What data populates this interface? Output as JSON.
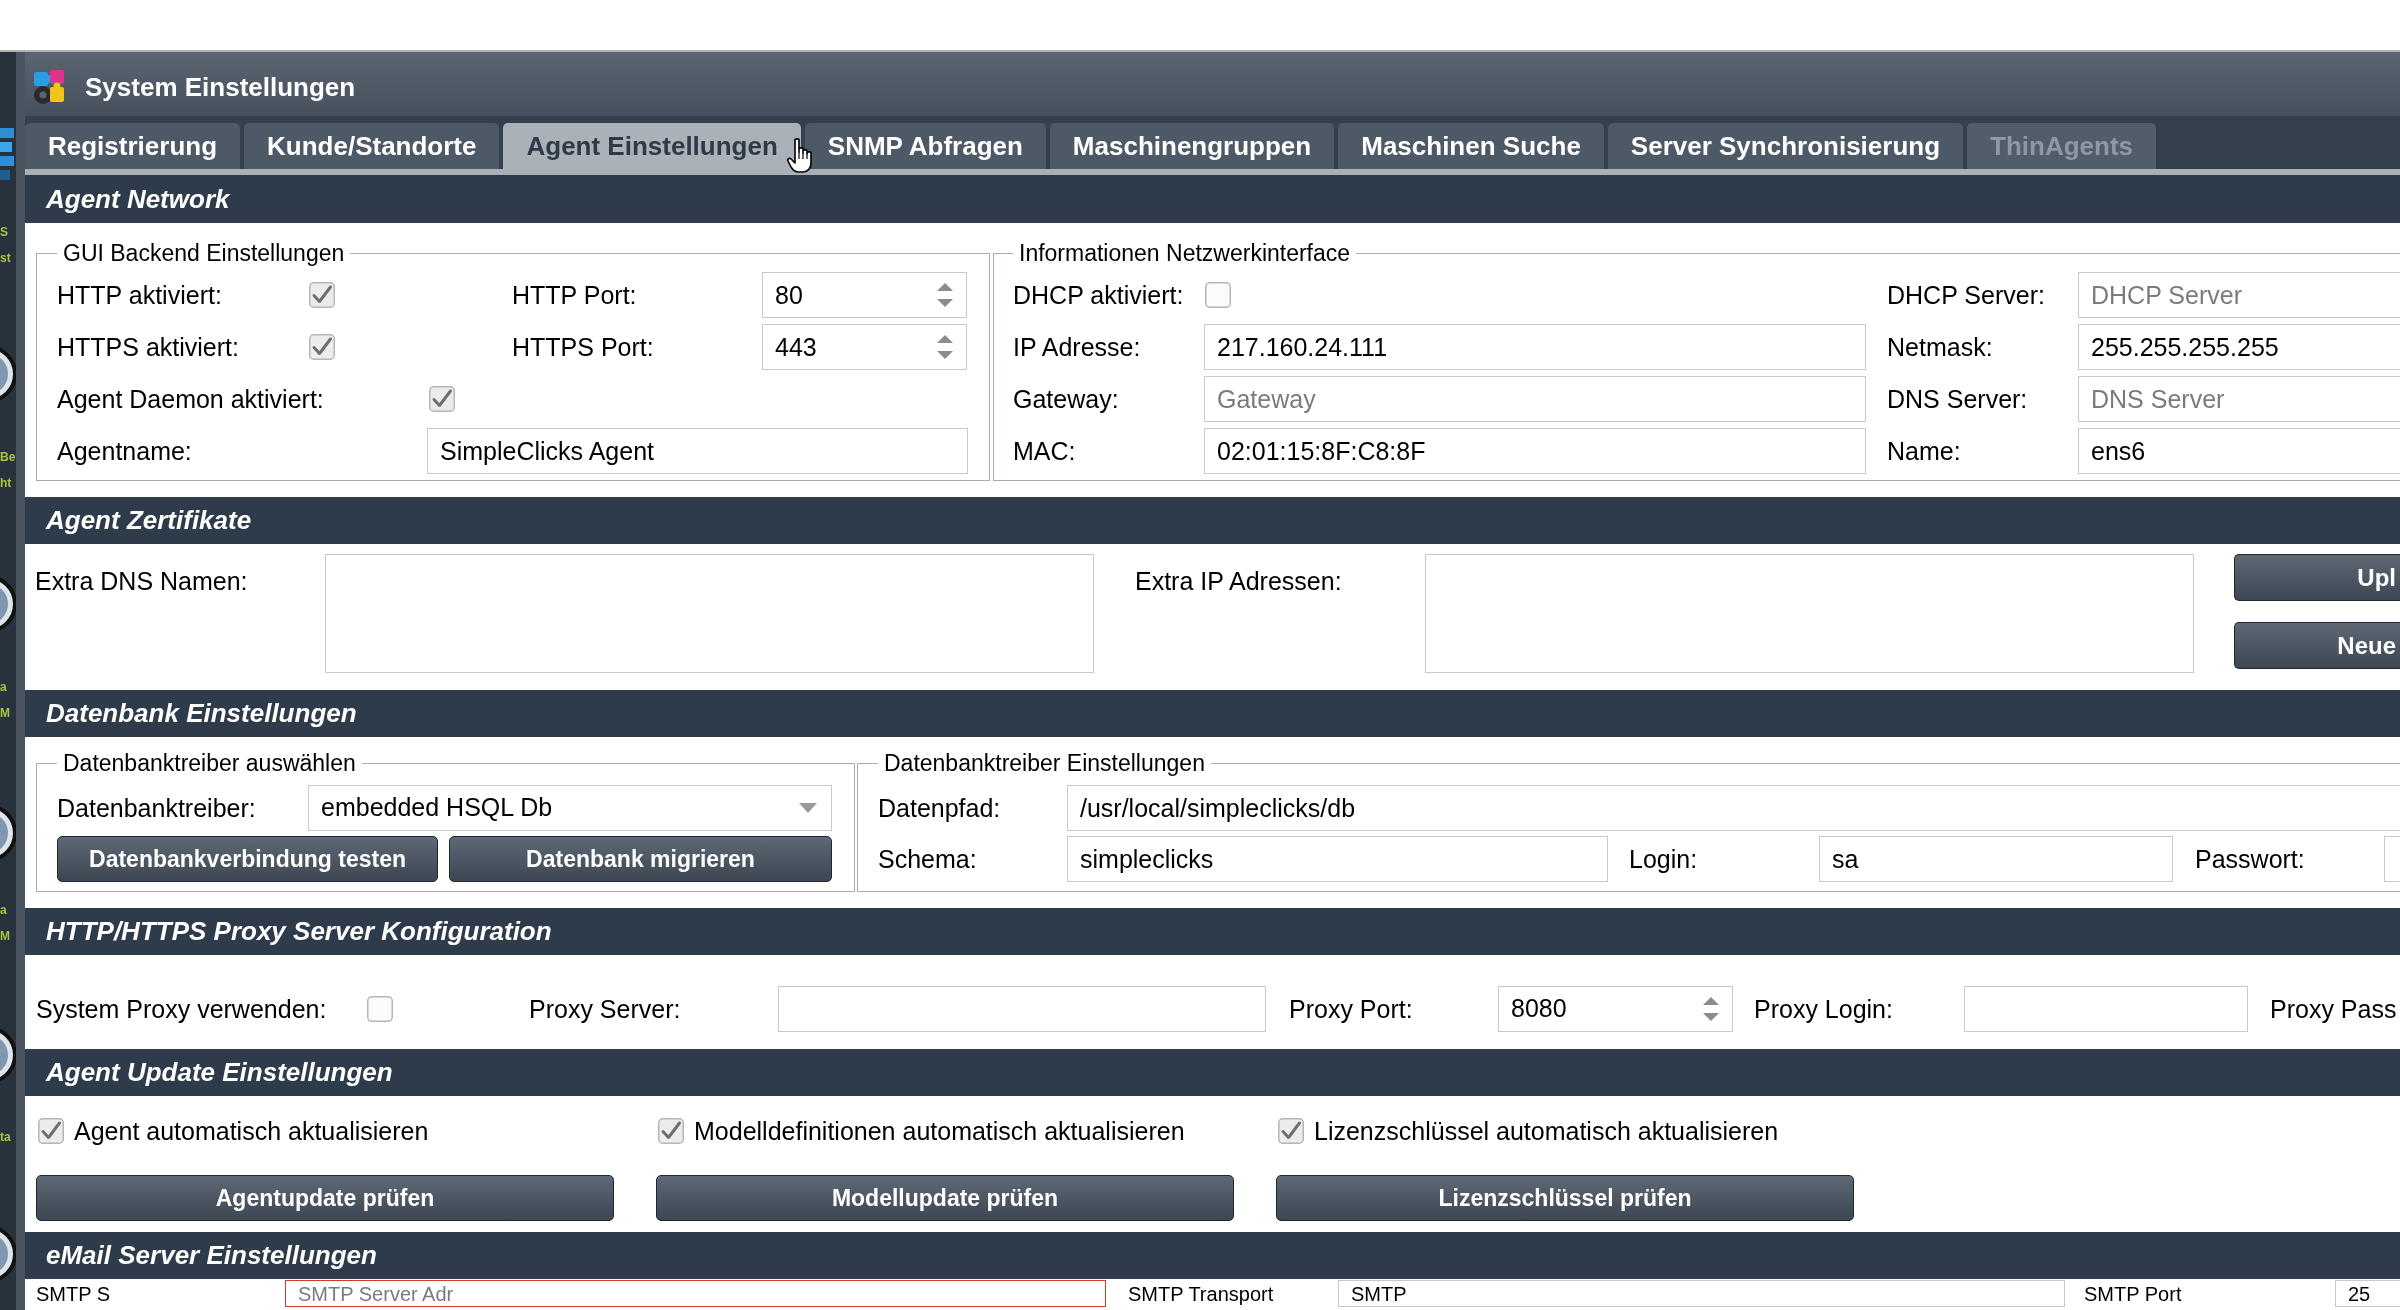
{
  "desktop": {
    "icons": [
      {
        "lines": [
          "S",
          "st"
        ]
      },
      {
        "lines": [
          "Be",
          "ht"
        ]
      },
      {
        "lines": [
          "a",
          "M"
        ]
      },
      {
        "lines": [
          "a",
          "M"
        ]
      },
      {
        "lines": [
          "ta"
        ]
      }
    ]
  },
  "window": {
    "title": "System Einstellungen"
  },
  "tabs": [
    {
      "label": "Registrierung",
      "selected": false,
      "disabled": false
    },
    {
      "label": "Kunde/Standorte",
      "selected": false,
      "disabled": false
    },
    {
      "label": "Agent Einstellungen",
      "selected": true,
      "disabled": false
    },
    {
      "label": "SNMP Abfragen",
      "selected": false,
      "disabled": false
    },
    {
      "label": "Maschinengruppen",
      "selected": false,
      "disabled": false
    },
    {
      "label": "Maschinen Suche",
      "selected": false,
      "disabled": false
    },
    {
      "label": "Server Synchronisierung",
      "selected": false,
      "disabled": false
    },
    {
      "label": "ThinAgents",
      "selected": false,
      "disabled": true
    }
  ],
  "agent_network": {
    "title": "Agent Network",
    "gui_backend": {
      "legend": "GUI Backend Einstellungen",
      "http_enabled": {
        "label": "HTTP aktiviert:",
        "checked": true
      },
      "http_port": {
        "label": "HTTP Port:",
        "value": "80"
      },
      "https_enabled": {
        "label": "HTTPS aktiviert:",
        "checked": true
      },
      "https_port": {
        "label": "HTTPS Port:",
        "value": "443"
      },
      "daemon_enabled": {
        "label": "Agent Daemon aktiviert:",
        "checked": true
      },
      "agent_name": {
        "label": "Agentname:",
        "value": "SimpleClicks Agent"
      }
    },
    "network_interface": {
      "legend": "Informationen Netzwerkinterface",
      "dhcp_enabled": {
        "label": "DHCP aktiviert:",
        "checked": false
      },
      "dhcp_server": {
        "label": "DHCP Server:",
        "placeholder": "DHCP Server"
      },
      "ip_address": {
        "label": "IP Adresse:",
        "value": "217.160.24.111"
      },
      "netmask": {
        "label": "Netmask:",
        "value": "255.255.255.255"
      },
      "gateway": {
        "label": "Gateway:",
        "placeholder": "Gateway"
      },
      "dns_server": {
        "label": "DNS Server:",
        "placeholder": "DNS Server"
      },
      "mac": {
        "label": "MAC:",
        "value": "02:01:15:8F:C8:8F"
      },
      "name": {
        "label": "Name:",
        "value": "ens6"
      }
    }
  },
  "agent_certificates": {
    "title": "Agent Zertifikate",
    "extra_dns": {
      "label": "Extra DNS Namen:"
    },
    "extra_ip": {
      "label": "Extra IP Adressen:"
    },
    "buttons": [
      "Upl",
      "Neue"
    ]
  },
  "database": {
    "title": "Datenbank Einstellungen",
    "driver_select": {
      "legend": "Datenbanktreiber auswählen",
      "label": "Datenbanktreiber:",
      "value": "embedded HSQL Db",
      "buttons": [
        "Datenbankverbindung testen",
        "Datenbank migrieren"
      ]
    },
    "driver_settings": {
      "legend": "Datenbanktreiber Einstellungen",
      "path": {
        "label": "Datenpfad:",
        "value": "/usr/local/simpleclicks/db"
      },
      "schema": {
        "label": "Schema:",
        "value": "simpleclicks"
      },
      "login": {
        "label": "Login:",
        "value": "sa"
      },
      "password": {
        "label": "Passwort:"
      }
    }
  },
  "proxy": {
    "title": "HTTP/HTTPS Proxy Server Konfiguration",
    "use_system_proxy": {
      "label": "System Proxy verwenden:",
      "checked": false
    },
    "server": {
      "label": "Proxy Server:"
    },
    "port": {
      "label": "Proxy Port:",
      "value": "8080"
    },
    "login": {
      "label": "Proxy Login:"
    },
    "password": {
      "label": "Proxy Pass"
    }
  },
  "agent_update": {
    "title": "Agent Update Einstellungen",
    "options": [
      {
        "label": "Agent automatisch aktualisieren",
        "checked": true
      },
      {
        "label": "Modelldefinitionen automatisch aktualisieren",
        "checked": true
      },
      {
        "label": "Lizenzschlüssel automatisch aktualisieren",
        "checked": true
      }
    ],
    "buttons": [
      "Agentupdate prüfen",
      "Modellupdate prüfen",
      "Lizenzschlüssel prüfen"
    ]
  },
  "email": {
    "title": "eMail Server Einstellungen",
    "smtp_server": {
      "label": "SMTP S",
      "placeholder": "SMTP Server Adr",
      "invalid": true
    },
    "smtp_transport": {
      "label": "SMTP Transport",
      "value": "SMTP"
    },
    "smtp_port": {
      "label": "SMTP Port",
      "value": "25"
    }
  }
}
